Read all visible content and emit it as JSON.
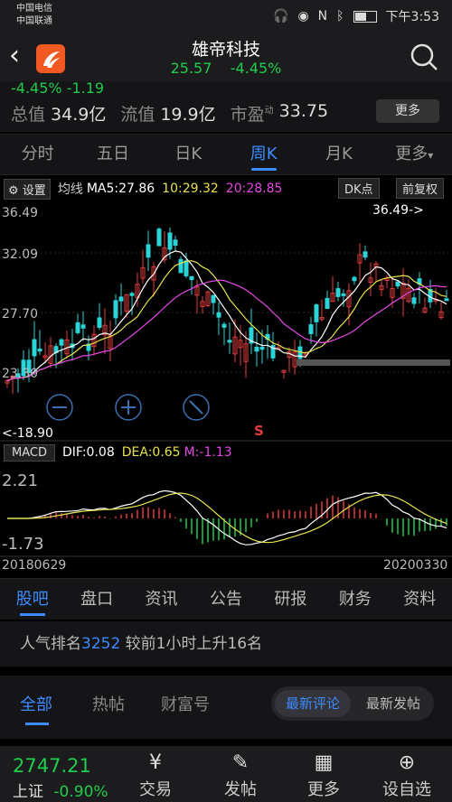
{
  "status_bar": {
    "carrier1": "中国电信",
    "carrier2": "中国联通",
    "time": "下午3:53"
  },
  "header": {
    "title": "雄帝科技",
    "price": "25.57",
    "change_pct": "-4.45%"
  },
  "info": {
    "cut_text": "-4.45%  -1.19",
    "total_value_label": "总值",
    "total_value": "34.9亿",
    "float_label": "流值",
    "float_value": "19.9亿",
    "pe_label": "市盈",
    "pe_sup": "动",
    "pe_value": "33.75",
    "more_label": "更多"
  },
  "period_tabs": [
    {
      "label": "分时",
      "active": false
    },
    {
      "label": "五日",
      "active": false
    },
    {
      "label": "日K",
      "active": false
    },
    {
      "label": "周K",
      "active": true
    },
    {
      "label": "月K",
      "active": false
    },
    {
      "label": "更多",
      "active": false
    }
  ],
  "chart_toolbar": {
    "settings_label": "设置",
    "ma_label": "均线",
    "ma5": "MA5:27.86",
    "ma10": "10:29.32",
    "ma20": "20:28.85",
    "dk_label": "DK点",
    "fq_label": "前复权"
  },
  "chart_labels": {
    "y1": "36.49",
    "y2": "32.09",
    "y3": "27.70",
    "y4": "23.30",
    "high_marker": "36.49->",
    "low_marker": "<-18.90",
    "s_marker": "S",
    "macd_top": "2.21",
    "macd_bottom": "-1.73",
    "date_start": "20180629",
    "date_end": "20200330"
  },
  "macd": {
    "label": "MACD",
    "dif": "DIF:0.08",
    "dea": "DEA:0.65",
    "m": "M:-1.13"
  },
  "colors": {
    "up": "#e23b3b",
    "down": "#2ad4d8",
    "ma5": "#ffffff",
    "ma10": "#e8e34d",
    "ma20": "#e548e5",
    "accent": "#3d8bff",
    "green": "#1fcc4c"
  },
  "chart_data": {
    "type": "candlestick",
    "period": "weekly",
    "x_range": [
      "20180629",
      "20200330"
    ],
    "ylim": [
      18.9,
      36.49
    ],
    "high": 36.49,
    "low": 18.9,
    "ma": {
      "MA5": 27.86,
      "MA10": 29.32,
      "MA20": 28.85
    },
    "macd": {
      "DIF": 0.08,
      "DEA": 0.65,
      "M": -1.13,
      "ylim": [
        -1.73,
        2.21
      ]
    }
  },
  "guba_tabs": [
    "股吧",
    "盘口",
    "资讯",
    "公告",
    "研报",
    "财务",
    "资料"
  ],
  "rank": {
    "prefix": "人气排名",
    "number": "3252",
    "suffix": " 较前1小时上升16名"
  },
  "feed_tabs": {
    "all": "全部",
    "hot": "热帖",
    "wealth": "财富号",
    "latest_comment": "最新评论",
    "latest_post": "最新发帖"
  },
  "bottom_nav": {
    "index_value": "2747.21",
    "index_name": "上证",
    "index_change": "-0.90%",
    "items": [
      "交易",
      "发帖",
      "更多",
      "设自选"
    ]
  }
}
